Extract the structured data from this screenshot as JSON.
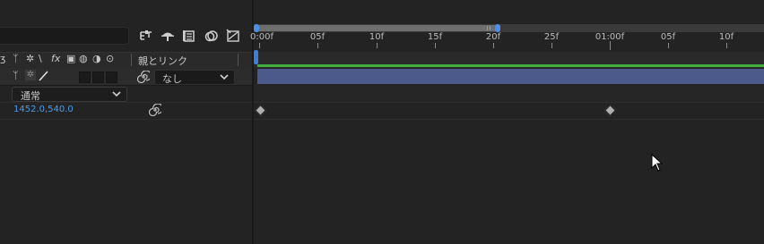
{
  "header": {
    "parent_link_label": "親とリンク",
    "switch_glyphs": [
      "ʒ",
      "ᛉ",
      "✲",
      "\\",
      "fx",
      "▣",
      "◍",
      "◑",
      "⊙"
    ]
  },
  "layer": {
    "parent_value": "なし",
    "blend_mode": "通常"
  },
  "properties": {
    "position_value": "1452.0,540.0"
  },
  "timeline": {
    "ruler_labels": [
      "0:00f",
      "05f",
      "10f",
      "15f",
      "20f",
      "25f",
      "01:00f",
      "05f",
      "10f"
    ]
  },
  "colors": {
    "accent": "#4d8ee6",
    "layer_bar": "#4b5a8a",
    "green_line": "#3fae3f",
    "value_text": "#4d9be6"
  }
}
